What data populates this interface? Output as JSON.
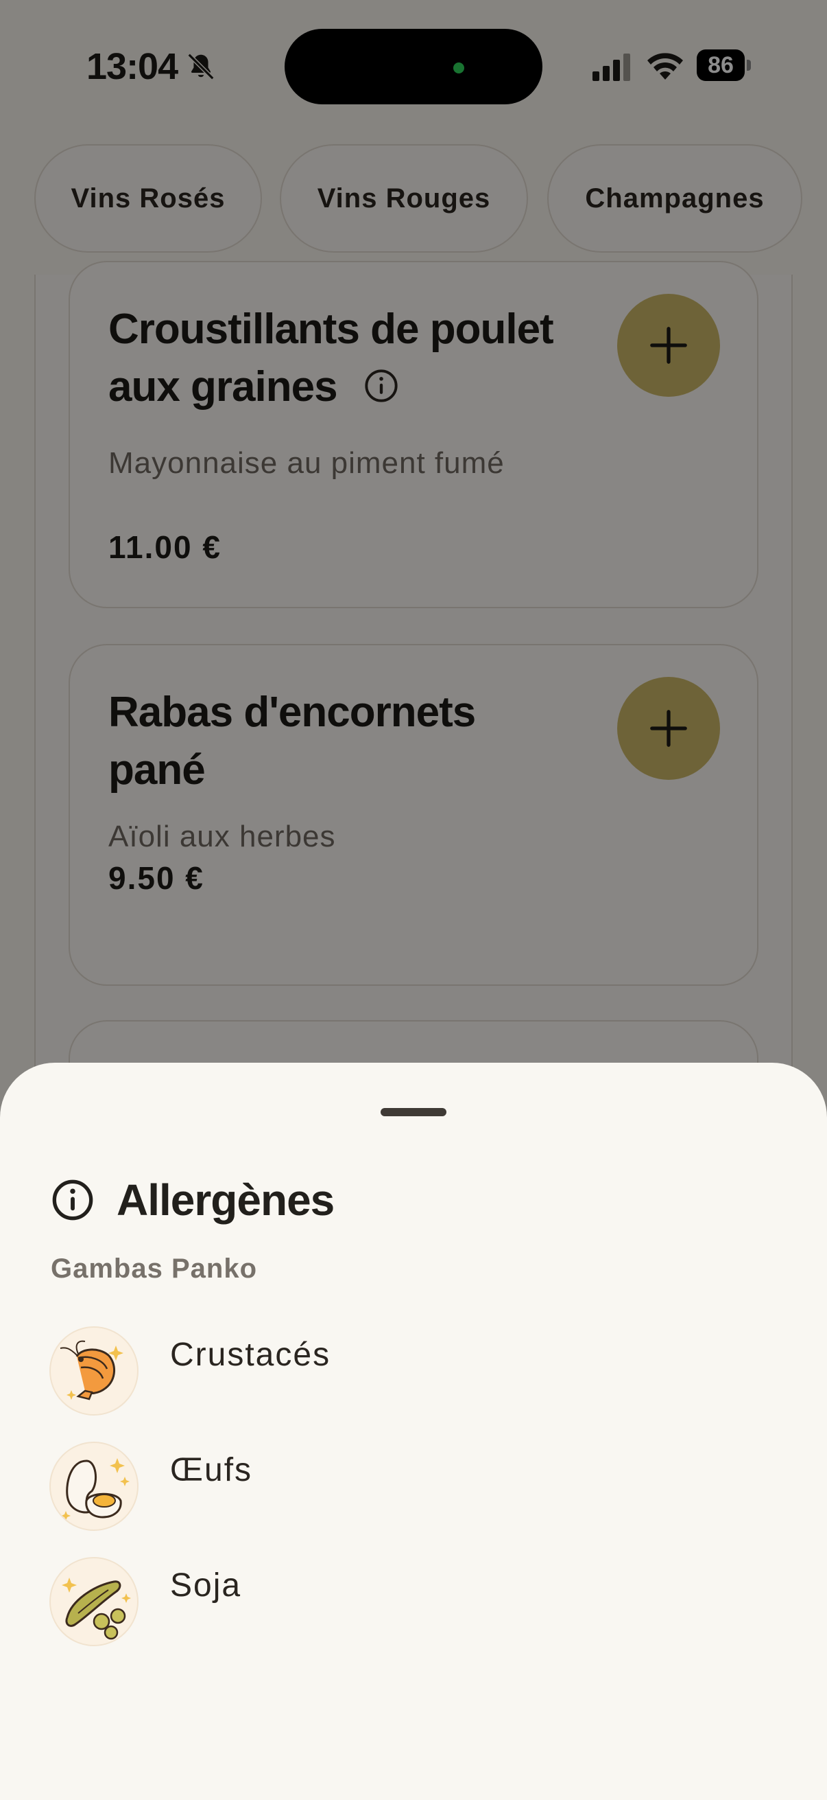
{
  "status_bar": {
    "time": "13:04",
    "battery": "86"
  },
  "categories": [
    "Vins Rosés",
    "Vins Rouges",
    "Champagnes"
  ],
  "menu_items": [
    {
      "title_line1": "Croustillants de poulet",
      "title_line2": "aux graines",
      "description": "Mayonnaise au piment fumé",
      "price": "11.00 €"
    },
    {
      "title_line1": "Rabas d'encornets",
      "title_line2": "pané",
      "description": "Aïoli aux herbes",
      "price": "9.50 €"
    }
  ],
  "sheet": {
    "title": "Allergènes",
    "subtitle": "Gambas Panko",
    "allergens": [
      {
        "label": "Crustacés",
        "icon": "shrimp-icon"
      },
      {
        "label": "Œufs",
        "icon": "egg-icon"
      },
      {
        "label": "Soja",
        "icon": "soy-icon"
      }
    ]
  },
  "colors": {
    "accent": "#c9b466",
    "sheet_bg": "#f9f7f2",
    "text": "#2a2520"
  }
}
